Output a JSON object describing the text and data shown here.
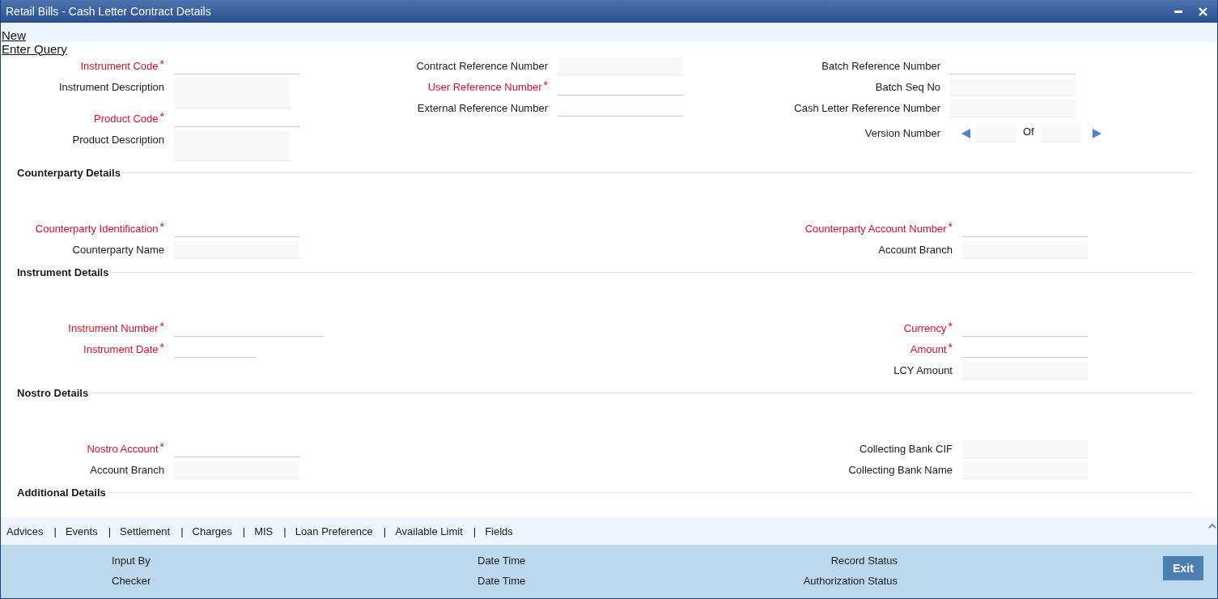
{
  "window": {
    "title": "Retail Bills - Cash Letter Contract Details"
  },
  "toolbar": {
    "links": [
      "New",
      "Enter Query"
    ]
  },
  "header": {
    "columns": [
      [
        {
          "label": "Instrument Code",
          "required": true,
          "asterisk": "*",
          "kind": "input"
        },
        {
          "label": "Instrument Description",
          "required": false,
          "kind": "memo"
        },
        {
          "label": "Product Code",
          "required": true,
          "asterisk": "*",
          "kind": "input"
        },
        {
          "label": "Product Description",
          "required": false,
          "kind": "memo"
        }
      ],
      [
        {
          "label": "Contract Reference Number",
          "required": false,
          "kind": "display"
        },
        {
          "label": "User Reference Number",
          "required": true,
          "asterisk": "*",
          "kind": "input"
        },
        {
          "label": "External Reference Number",
          "required": false,
          "kind": "input"
        }
      ],
      [
        {
          "label": "Batch Reference Number",
          "required": false,
          "kind": "input"
        },
        {
          "label": "Batch Seq No",
          "required": false,
          "kind": "display"
        },
        {
          "label": "Cash Letter Reference Number",
          "required": false,
          "kind": "display"
        },
        {
          "label": "Version Number",
          "required": false,
          "kind": "version",
          "of": "Of"
        }
      ]
    ]
  },
  "sections": [
    {
      "title": "Counterparty Details",
      "columns": [
        [
          {
            "label": "Counterparty Identification",
            "required": true,
            "asterisk": "*",
            "kind": "input"
          },
          {
            "label": "Counterparty Name",
            "required": false,
            "kind": "display"
          }
        ],
        [
          {
            "label": "Counterparty Account Number",
            "required": true,
            "asterisk": "*",
            "kind": "input"
          },
          {
            "label": "Account Branch",
            "required": false,
            "kind": "display"
          }
        ]
      ]
    },
    {
      "title": "Instrument Details",
      "columns": [
        [
          {
            "label": "Instrument Number",
            "required": true,
            "asterisk": "*",
            "kind": "long"
          },
          {
            "label": "Instrument Date",
            "required": true,
            "asterisk": "*",
            "kind": "date"
          }
        ],
        [
          {
            "label": "Currency",
            "required": true,
            "asterisk": "*",
            "kind": "input"
          },
          {
            "label": "Amount",
            "required": true,
            "asterisk": "*",
            "kind": "input"
          },
          {
            "label": "LCY Amount",
            "required": false,
            "kind": "display"
          }
        ]
      ]
    },
    {
      "title": "Nostro Details",
      "columns": [
        [
          {
            "label": "Nostro Account",
            "required": true,
            "asterisk": "*",
            "kind": "input"
          },
          {
            "label": "Account Branch",
            "required": false,
            "kind": "display"
          }
        ],
        [
          {
            "label": "Collecting Bank CIF",
            "required": false,
            "kind": "display"
          },
          {
            "label": "Collecting Bank Name",
            "required": false,
            "kind": "display"
          }
        ]
      ]
    },
    {
      "title": "Additional Details"
    }
  ],
  "tabs": {
    "separator": "|",
    "items": [
      "Advices",
      "Events",
      "Settlement",
      "Charges",
      "MIS",
      "Loan Preference",
      "Available Limit",
      "Fields"
    ]
  },
  "footer": {
    "rows": [
      [
        "Input By",
        "Date Time",
        "Record Status"
      ],
      [
        "Checker",
        "Date Time",
        "Authorization Status"
      ]
    ],
    "exit_button": "Exit"
  }
}
